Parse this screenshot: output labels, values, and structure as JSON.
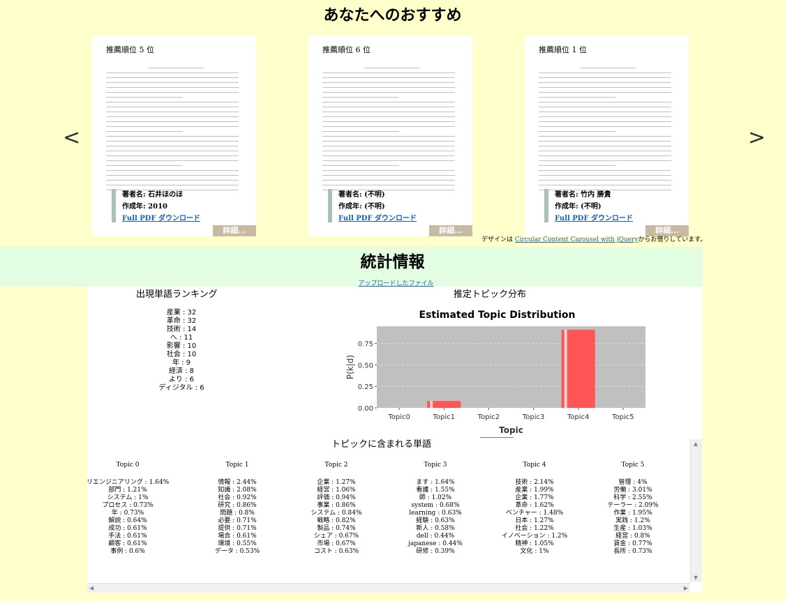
{
  "recommendations": {
    "title": "あなたへのおすすめ",
    "prev_label": "<",
    "next_label": ">",
    "cards": [
      {
        "rank": "推薦順位 5 位",
        "author": "著者名: 石井ほのほ",
        "year": "作成年: 2010",
        "pdf_link": "Full PDF ダウンロード",
        "details": "詳細..."
      },
      {
        "rank": "推薦順位 6 位",
        "author": "著者名: (不明)",
        "year": "作成年: (不明)",
        "pdf_link": "Full PDF ダウンロード",
        "details": "詳細..."
      },
      {
        "rank": "推薦順位 1 位",
        "author": "著者名: 竹内 勝貴",
        "year": "作成年: (不明)",
        "pdf_link": "Full PDF ダウンロード",
        "details": "詳細..."
      }
    ],
    "credit_prefix": "デザインは ",
    "credit_link": "Circular Content Carousel with jQuery",
    "credit_suffix": "からお借りしています。"
  },
  "stats": {
    "title": "統計情報",
    "uploaded_link": "アップロードしたファイル",
    "ranking_title": "出現単語ランキング",
    "ranking": [
      "産業 : 32",
      "革命 : 32",
      "技術 : 14",
      "へ : 11",
      "影響 : 10",
      "社会 : 10",
      "年 : 9",
      "経済 : 8",
      "より : 6",
      "ディジタル : 6"
    ],
    "topic_dist_title": "推定トピック分布",
    "words_title": "トピックに含まれる単語"
  },
  "chart_data": {
    "type": "bar",
    "title": "Estimated Topic Distribution",
    "xlabel": "Topic",
    "ylabel": "P(k|d)",
    "categories": [
      "Topic0",
      "Topic1",
      "Topic2",
      "Topic3",
      "Topic4",
      "Topic5"
    ],
    "values": [
      0.0,
      0.08,
      0.0,
      0.0,
      0.91,
      0.0
    ],
    "yticks": [
      "0.00",
      "0.25",
      "0.50",
      "0.75"
    ],
    "ylim": [
      0,
      0.95
    ],
    "grid": true,
    "colors": {
      "bar": "#ff5555",
      "plot_bg": "#c0c0c0",
      "grid": "#e0e0e0"
    }
  },
  "topic_words": [
    {
      "name": "Topic 0",
      "words": [
        "リエンジニアリング : 1.64%",
        "部門 : 1.21%",
        "システム : 1%",
        "プロセス : 0.73%",
        "年 : 0.73%",
        "解説 : 0.64%",
        "成功 : 0.61%",
        "手法 : 0.61%",
        "顧客 : 0.61%",
        "事例 : 0.6%"
      ]
    },
    {
      "name": "Topic 1",
      "words": [
        "情報 : 2.44%",
        "知識 : 2.08%",
        "社会 : 0.92%",
        "研究 : 0.86%",
        "問題 : 0.8%",
        "必要 : 0.71%",
        "提供 : 0.71%",
        "場合 : 0.61%",
        "環境 : 0.55%",
        "データ : 0.53%"
      ]
    },
    {
      "name": "Topic 2",
      "words": [
        "企業 : 1.27%",
        "経営 : 1.06%",
        "評価 : 0.94%",
        "事業 : 0.86%",
        "システム : 0.84%",
        "戦略 : 0.82%",
        "製品 : 0.74%",
        "シェア : 0.67%",
        "市場 : 0.67%",
        "コスト : 0.63%"
      ]
    },
    {
      "name": "Topic 3",
      "words": [
        "ます : 1.64%",
        "看護 : 1.55%",
        "師 : 1.02%",
        "system : 0.68%",
        "learning : 0.63%",
        "経験 : 0.63%",
        "新人 : 0.58%",
        "dell : 0.44%",
        "japanese : 0.44%",
        "研修 : 0.39%"
      ]
    },
    {
      "name": "Topic 4",
      "words": [
        "技術 : 2.14%",
        "産業 : 1.99%",
        "企業 : 1.77%",
        "革命 : 1.62%",
        "ベンチャー : 1.48%",
        "日本 : 1.27%",
        "社会 : 1.22%",
        "イノベーション : 1.2%",
        "精神 : 1.05%",
        "文化 : 1%"
      ]
    },
    {
      "name": "Topic 5",
      "words": [
        "管理 : 4%",
        "労働 : 3.01%",
        "科学 : 2.55%",
        "テーラー : 2.09%",
        "作業 : 1.95%",
        "実践 : 1.2%",
        "生産 : 1.03%",
        "経営 : 0.8%",
        "賃金 : 0.77%",
        "長所 : 0.73%"
      ]
    }
  ]
}
